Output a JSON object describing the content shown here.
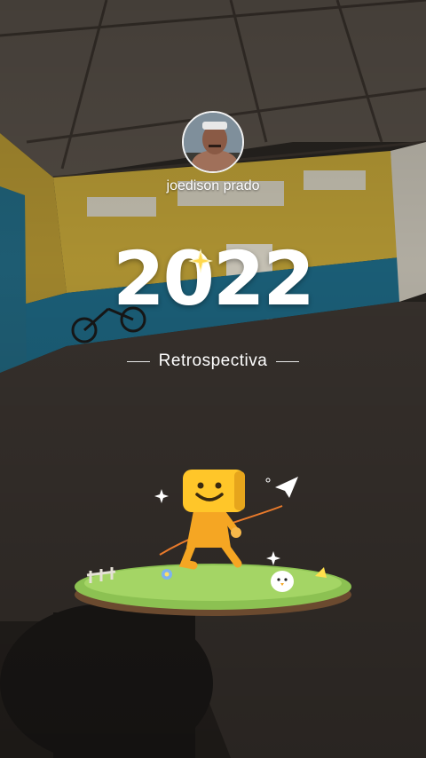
{
  "profile": {
    "name": "joedison prado",
    "avatar_icon": "profile-photo"
  },
  "hero": {
    "year": "2022",
    "subtitle": "Retrospectiva"
  },
  "colors": {
    "wall_yellow": "#d9b43a",
    "wall_blue": "#1e6f8f",
    "floor": "#3a3430",
    "mascot": "#f5a623",
    "grass": "#8cc152"
  }
}
